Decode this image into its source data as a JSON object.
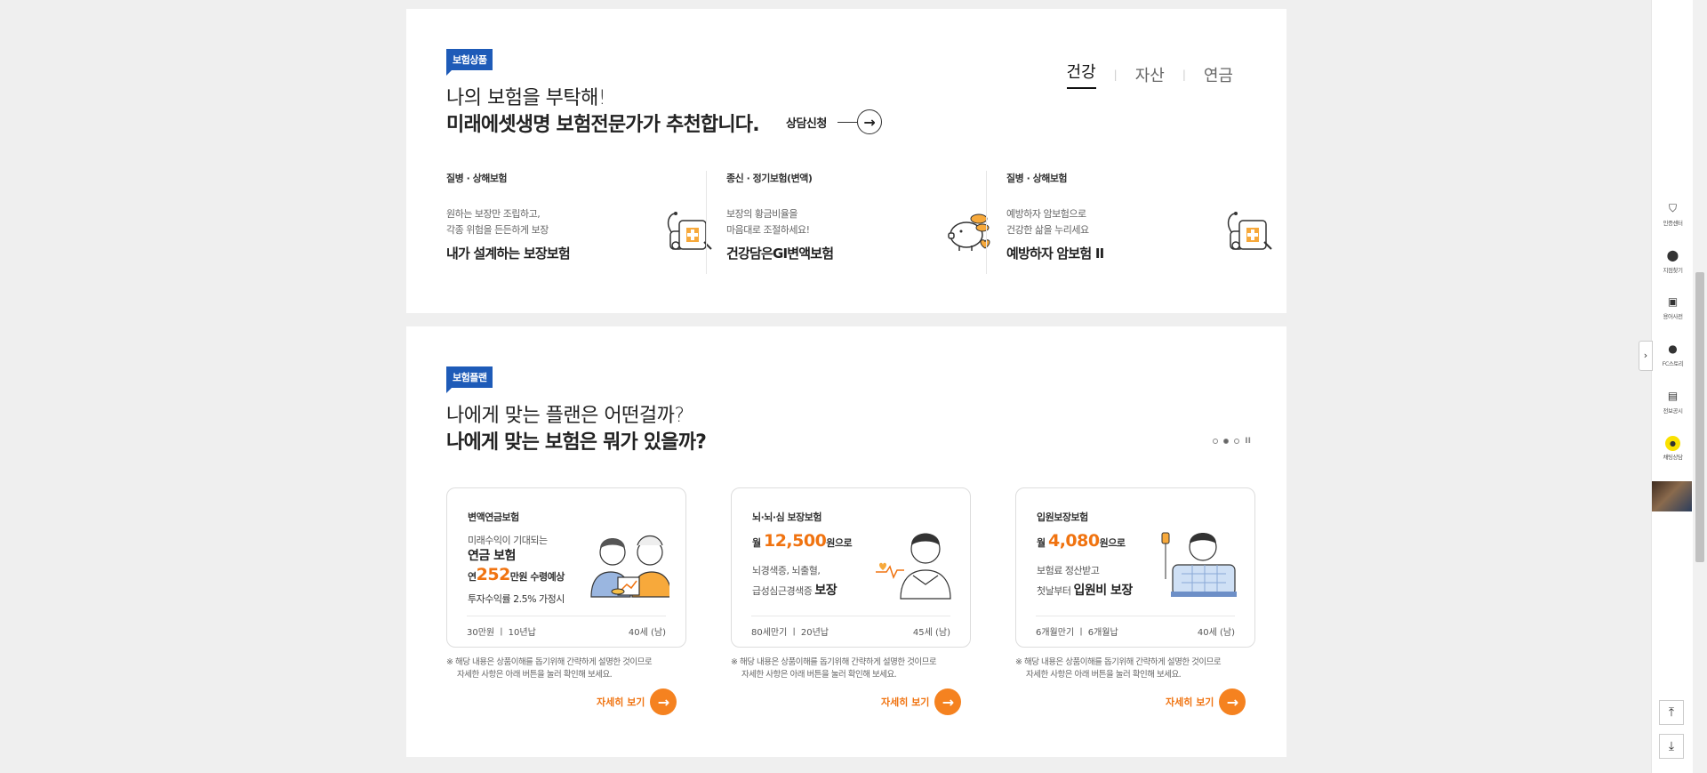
{
  "products_section": {
    "tag": "보험상품",
    "headline_light": "나의 보험을 부탁해!",
    "headline_bold": "미래에셋생명 보험전문가가 추천합니다.",
    "consult_label": "상담신청",
    "tabs": [
      {
        "label": "건강",
        "active": true
      },
      {
        "label": "자산",
        "active": false
      },
      {
        "label": "연금",
        "active": false
      }
    ],
    "products": [
      {
        "category": "질병 · 상해보험",
        "desc_line1": "원하는 보장만 조립하고,",
        "desc_line2": "각종 위험을 든든하게 보장",
        "name": "내가 설계하는 보장보험",
        "icon": "first-aid-kit-icon"
      },
      {
        "category": "종신 · 정기보험(변액)",
        "desc_line1": "보장의 황금비율을",
        "desc_line2": "마음대로 조절하세요!",
        "name": "건강담은GI변액보험",
        "icon": "piggy-bank-icon"
      },
      {
        "category": "질병 · 상해보험",
        "desc_line1": "예방하자 암보험으로",
        "desc_line2": "건강한 삶을 누리세요",
        "name": "예방하자 암보험 II",
        "icon": "first-aid-kit-icon"
      }
    ]
  },
  "plan_section": {
    "tag": "보험플랜",
    "headline_light": "나에게 맞는 플랜은 어떤걸까?",
    "headline_bold": "나에게 맞는 보험은 뭐가 있을까?",
    "pager": {
      "dots": 3,
      "active_index": 1,
      "pause_label": "II"
    },
    "cards": [
      {
        "title": "변액연금보험",
        "line1": "미래수익이 기대되는",
        "line2": "연금 보험",
        "line3_pre": "연",
        "line3_num": "252",
        "line3_post": "만원 수령예상",
        "line4": "투자수익률 2.5% 가정시",
        "foot_left": "30만원 ㅣ 10년납",
        "foot_right": "40세 (남)"
      },
      {
        "title": "뇌·뇌·심 보장보험",
        "amount_pre": "월",
        "amount_num": "12,500",
        "amount_post": "원으로",
        "line2": "뇌경색증, 뇌출혈,",
        "line3": "급성심근경색증",
        "line3_bold": "보장",
        "foot_left": "80세만기 ㅣ 20년납",
        "foot_right": "45세 (남)"
      },
      {
        "title": "입원보장보험",
        "amount_pre": "월",
        "amount_num": "4,080",
        "amount_post": "원으로",
        "line2": "보험료 정산받고",
        "line3": "첫날부터",
        "line3_bold": "입원비 보장",
        "foot_left": "6개월만기 ㅣ 6개월납",
        "foot_right": "40세 (남)"
      }
    ],
    "note_line1": "※ 해당 내용은 상품이해를 돕기위해 간략하게 설명한 것이므로",
    "note_line2": "자세한 사항은 아래 버튼을 눌러 확인해 보세요.",
    "more_label": "자세히 보기"
  },
  "sidebar": {
    "items": [
      {
        "label": "인증센터",
        "icon": "shield-icon"
      },
      {
        "label": "지점찾기",
        "icon": "location-pin-icon"
      },
      {
        "label": "용어사전",
        "icon": "dictionary-icon"
      },
      {
        "label": "FC스토리",
        "icon": "person-icon"
      },
      {
        "label": "전보공시",
        "icon": "document-icon"
      },
      {
        "label": "채팅상담",
        "icon": "kakao-chat-icon"
      }
    ],
    "toggle_glyph": "›",
    "top_glyph": "⤒",
    "bottom_glyph": "⤓"
  }
}
